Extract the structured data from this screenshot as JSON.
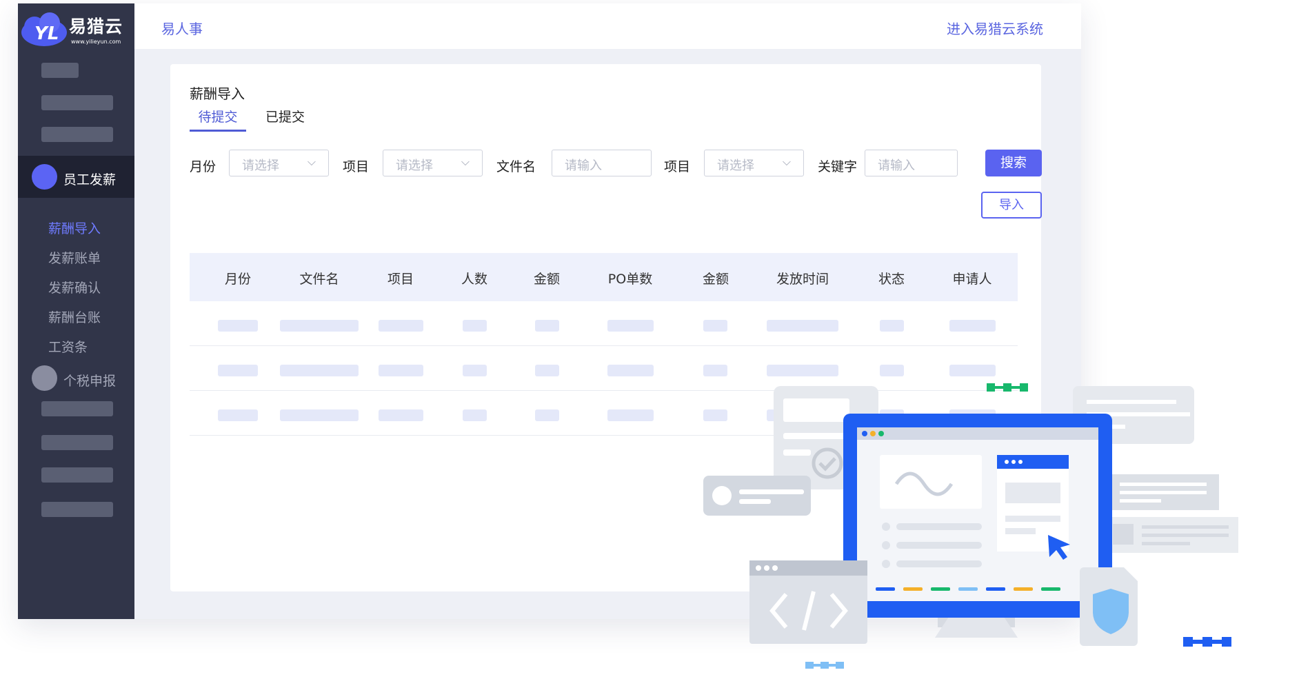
{
  "app": {
    "brand": "易猎云",
    "brand_url": "www.yilieyun.com",
    "breadcrumb": "易人事",
    "enter_system": "进入易猎云系统"
  },
  "sidebar": {
    "groups": [
      {
        "label": "员工发薪",
        "active": true,
        "dot_color": "#5b64f4"
      },
      {
        "label": "个税申报",
        "active": false,
        "dot_color": "#8a8da0"
      }
    ],
    "items": [
      {
        "label": "薪酬导入",
        "active": true
      },
      {
        "label": "发薪账单",
        "active": false
      },
      {
        "label": "发薪确认",
        "active": false
      },
      {
        "label": "薪酬台账",
        "active": false
      },
      {
        "label": "工资条",
        "active": false
      }
    ]
  },
  "page": {
    "title": "薪酬导入",
    "tabs": [
      {
        "label": "待提交",
        "active": true
      },
      {
        "label": "已提交",
        "active": false
      }
    ]
  },
  "filters": {
    "month_label": "月份",
    "month_placeholder": "请选择",
    "project_label": "项目",
    "project_placeholder": "请选择",
    "filename_label": "文件名",
    "filename_placeholder": "请输入",
    "project2_label": "项目",
    "project2_placeholder": "请选择",
    "keyword_label": "关键字",
    "keyword_placeholder": "请输入",
    "search_button": "搜索",
    "import_button": "导入"
  },
  "table": {
    "columns": [
      "月份",
      "文件名",
      "项目",
      "人数",
      "金额",
      "PO单数",
      "金额",
      "发放时间",
      "状态",
      "申请人"
    ],
    "row_count": 3
  },
  "colors": {
    "accent": "#5a63f0",
    "sidebar_bg": "#313549",
    "monitor_blue": "#1f5ef2"
  }
}
